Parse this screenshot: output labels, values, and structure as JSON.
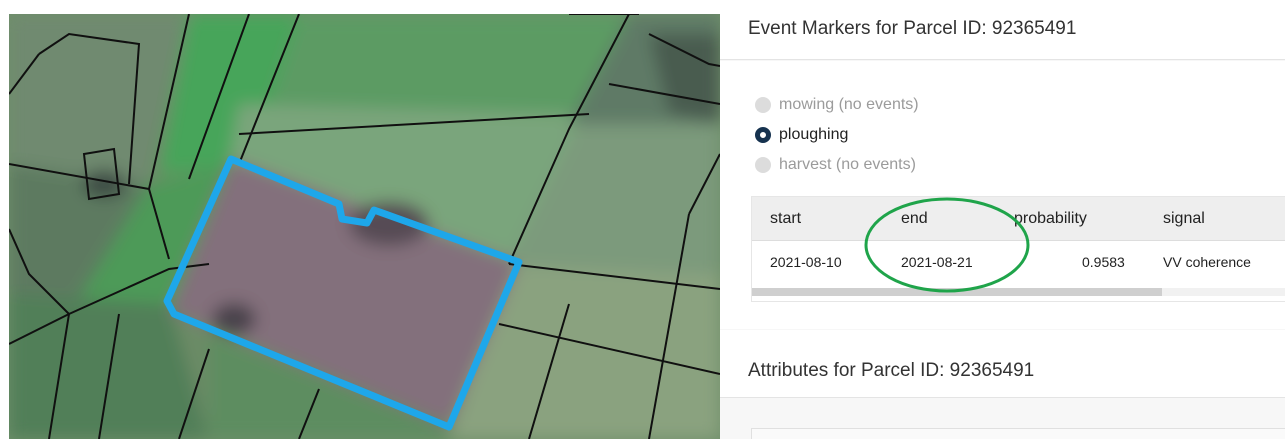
{
  "map": {
    "highlight_color": "#1ea7ea",
    "parcel_line_color": "#101010"
  },
  "events": {
    "title": "Event Markers for Parcel ID: 92365491",
    "options": [
      {
        "label": "mowing (no events)",
        "checked": false,
        "disabled": true
      },
      {
        "label": "ploughing",
        "checked": true,
        "disabled": false
      },
      {
        "label": "harvest (no events)",
        "checked": false,
        "disabled": true
      }
    ],
    "table": {
      "columns": [
        "start",
        "end",
        "probability",
        "signal"
      ],
      "rows": [
        [
          "2021-08-10",
          "2021-08-21",
          "0.9583",
          "VV coherence"
        ]
      ]
    }
  },
  "attributes": {
    "title": "Attributes for Parcel ID: 92365491"
  },
  "annotation": {
    "color": "#1fa44a"
  }
}
